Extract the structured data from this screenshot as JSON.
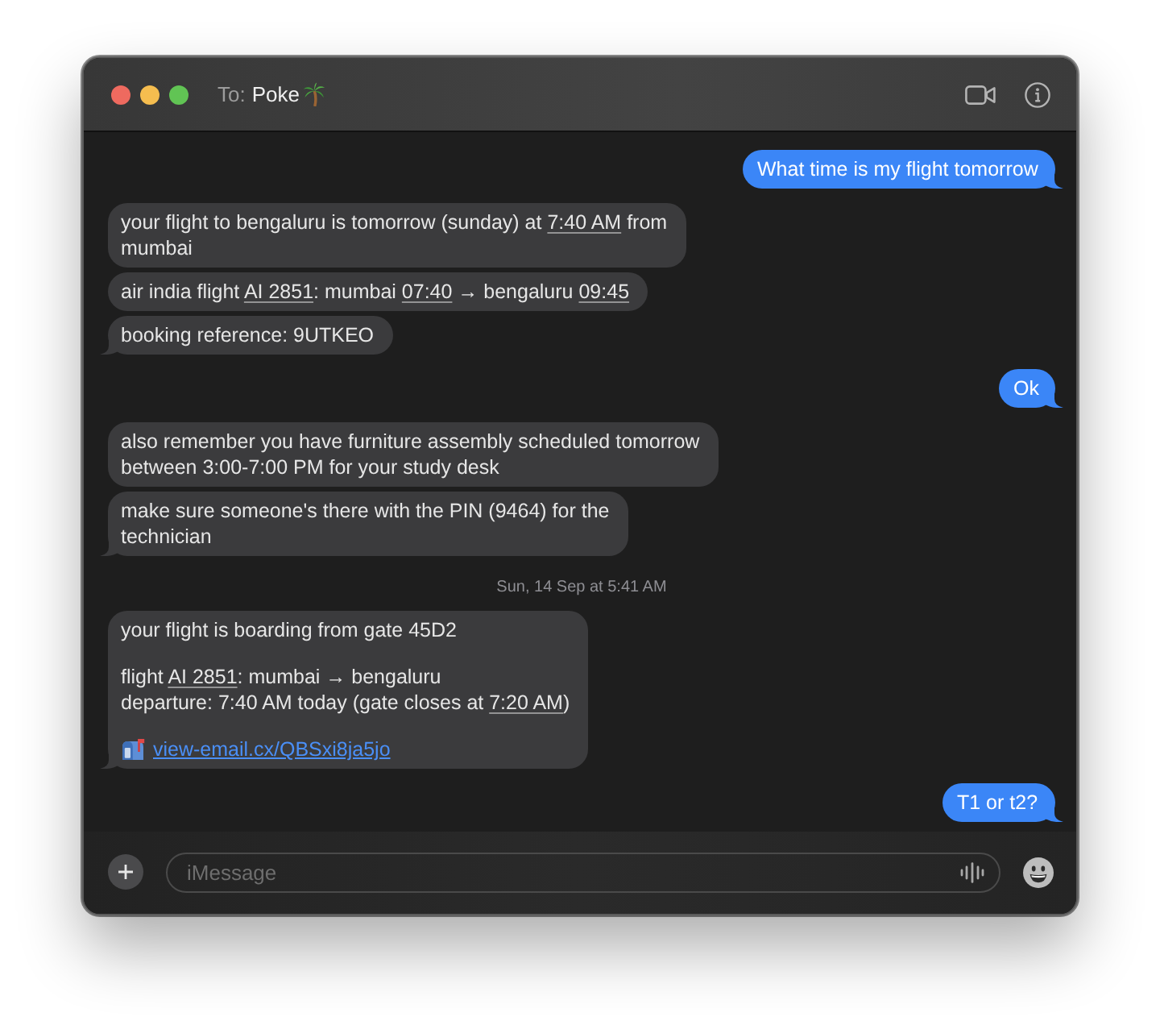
{
  "window": {
    "to_label": "To:",
    "recipient": "Poke"
  },
  "messages": [
    {
      "kind": "outgoing",
      "tail": true,
      "paragraphs": [
        {
          "kind": "text",
          "runs": [
            {
              "kind": "plain",
              "text": "What time is my flight tomorrow"
            }
          ]
        }
      ]
    },
    {
      "kind": "incoming",
      "tail": false,
      "paragraphs": [
        {
          "kind": "text",
          "runs": [
            {
              "kind": "plain",
              "text": "your flight to bengaluru is tomorrow (sunday) at "
            },
            {
              "kind": "detected",
              "text": "7:40 AM"
            },
            {
              "kind": "plain",
              "text": " from mumbai"
            }
          ]
        }
      ]
    },
    {
      "kind": "incoming",
      "tail": false,
      "paragraphs": [
        {
          "kind": "text",
          "runs": [
            {
              "kind": "plain",
              "text": "air india flight "
            },
            {
              "kind": "detected",
              "text": "AI 2851"
            },
            {
              "kind": "plain",
              "text": ": mumbai "
            },
            {
              "kind": "detected",
              "text": "07:40"
            },
            {
              "kind": "plain",
              "text": " → bengaluru "
            },
            {
              "kind": "detected",
              "text": "09:45"
            }
          ]
        }
      ]
    },
    {
      "kind": "incoming",
      "tail": true,
      "paragraphs": [
        {
          "kind": "text",
          "runs": [
            {
              "kind": "plain",
              "text": "booking reference: 9UTKEO"
            }
          ]
        }
      ]
    },
    {
      "kind": "outgoing",
      "tail": true,
      "paragraphs": [
        {
          "kind": "text",
          "runs": [
            {
              "kind": "plain",
              "text": "Ok"
            }
          ]
        }
      ]
    },
    {
      "kind": "incoming",
      "tail": false,
      "paragraphs": [
        {
          "kind": "text",
          "runs": [
            {
              "kind": "plain",
              "text": "also remember you have furniture assembly scheduled tomorrow between 3:00-7:00 PM for your study desk"
            }
          ]
        }
      ]
    },
    {
      "kind": "incoming",
      "tail": true,
      "paragraphs": [
        {
          "kind": "text",
          "runs": [
            {
              "kind": "plain",
              "text": "make sure someone's there with the PIN (9464) for the technician"
            }
          ]
        }
      ]
    },
    {
      "kind": "timestamp",
      "text": "Sun, 14 Sep at 5:41 AM"
    },
    {
      "kind": "incoming",
      "tail": true,
      "paragraphs": [
        {
          "kind": "text",
          "runs": [
            {
              "kind": "plain",
              "text": "your flight is boarding from gate 45D2"
            }
          ]
        },
        {
          "kind": "text",
          "runs": [
            {
              "kind": "plain",
              "text": "flight "
            },
            {
              "kind": "detected",
              "text": "AI 2851"
            },
            {
              "kind": "plain",
              "text": ": mumbai → bengaluru\ndeparture: 7:40 AM today (gate closes at "
            },
            {
              "kind": "detected",
              "text": "7:20 AM"
            },
            {
              "kind": "plain",
              "text": ")"
            }
          ]
        },
        {
          "kind": "link",
          "text": "view-email.cx/QBSxi8ja5jo"
        }
      ]
    },
    {
      "kind": "outgoing",
      "tail": true,
      "paragraphs": [
        {
          "kind": "text",
          "runs": [
            {
              "kind": "plain",
              "text": "T1 or t2?"
            }
          ]
        }
      ]
    }
  ],
  "composer": {
    "placeholder": "iMessage"
  }
}
